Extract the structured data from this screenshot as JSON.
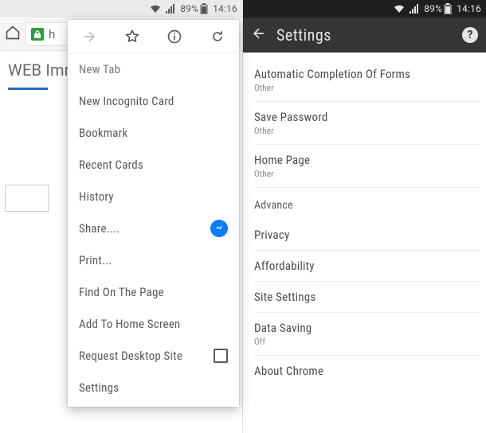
{
  "status": {
    "battery": "89%",
    "time": "14:16"
  },
  "left": {
    "url_fragment": "h",
    "tab_title": "WEB Imm",
    "menu_subtitle": "New Tab",
    "menu": {
      "items": [
        "New Incognito Card",
        "Bookmark",
        "Recent Cards",
        "History",
        "Share....",
        "Print...",
        "Find On The Page",
        "Add To Home Screen",
        "Request Desktop Site",
        "Settings"
      ]
    }
  },
  "right": {
    "title": "Settings",
    "items": [
      {
        "label": "Automatic Completion Of Forms",
        "sub": "Other"
      },
      {
        "label": "Save Password",
        "sub": "Other"
      },
      {
        "label": "Home Page",
        "sub": "Other"
      }
    ],
    "section": "Advance",
    "adv": [
      {
        "label": "Privacy"
      },
      {
        "label": "Affordability"
      },
      {
        "label": "Site Settings"
      },
      {
        "label": "Data Saving",
        "sub": "Off"
      },
      {
        "label": "About Chrome"
      }
    ]
  }
}
